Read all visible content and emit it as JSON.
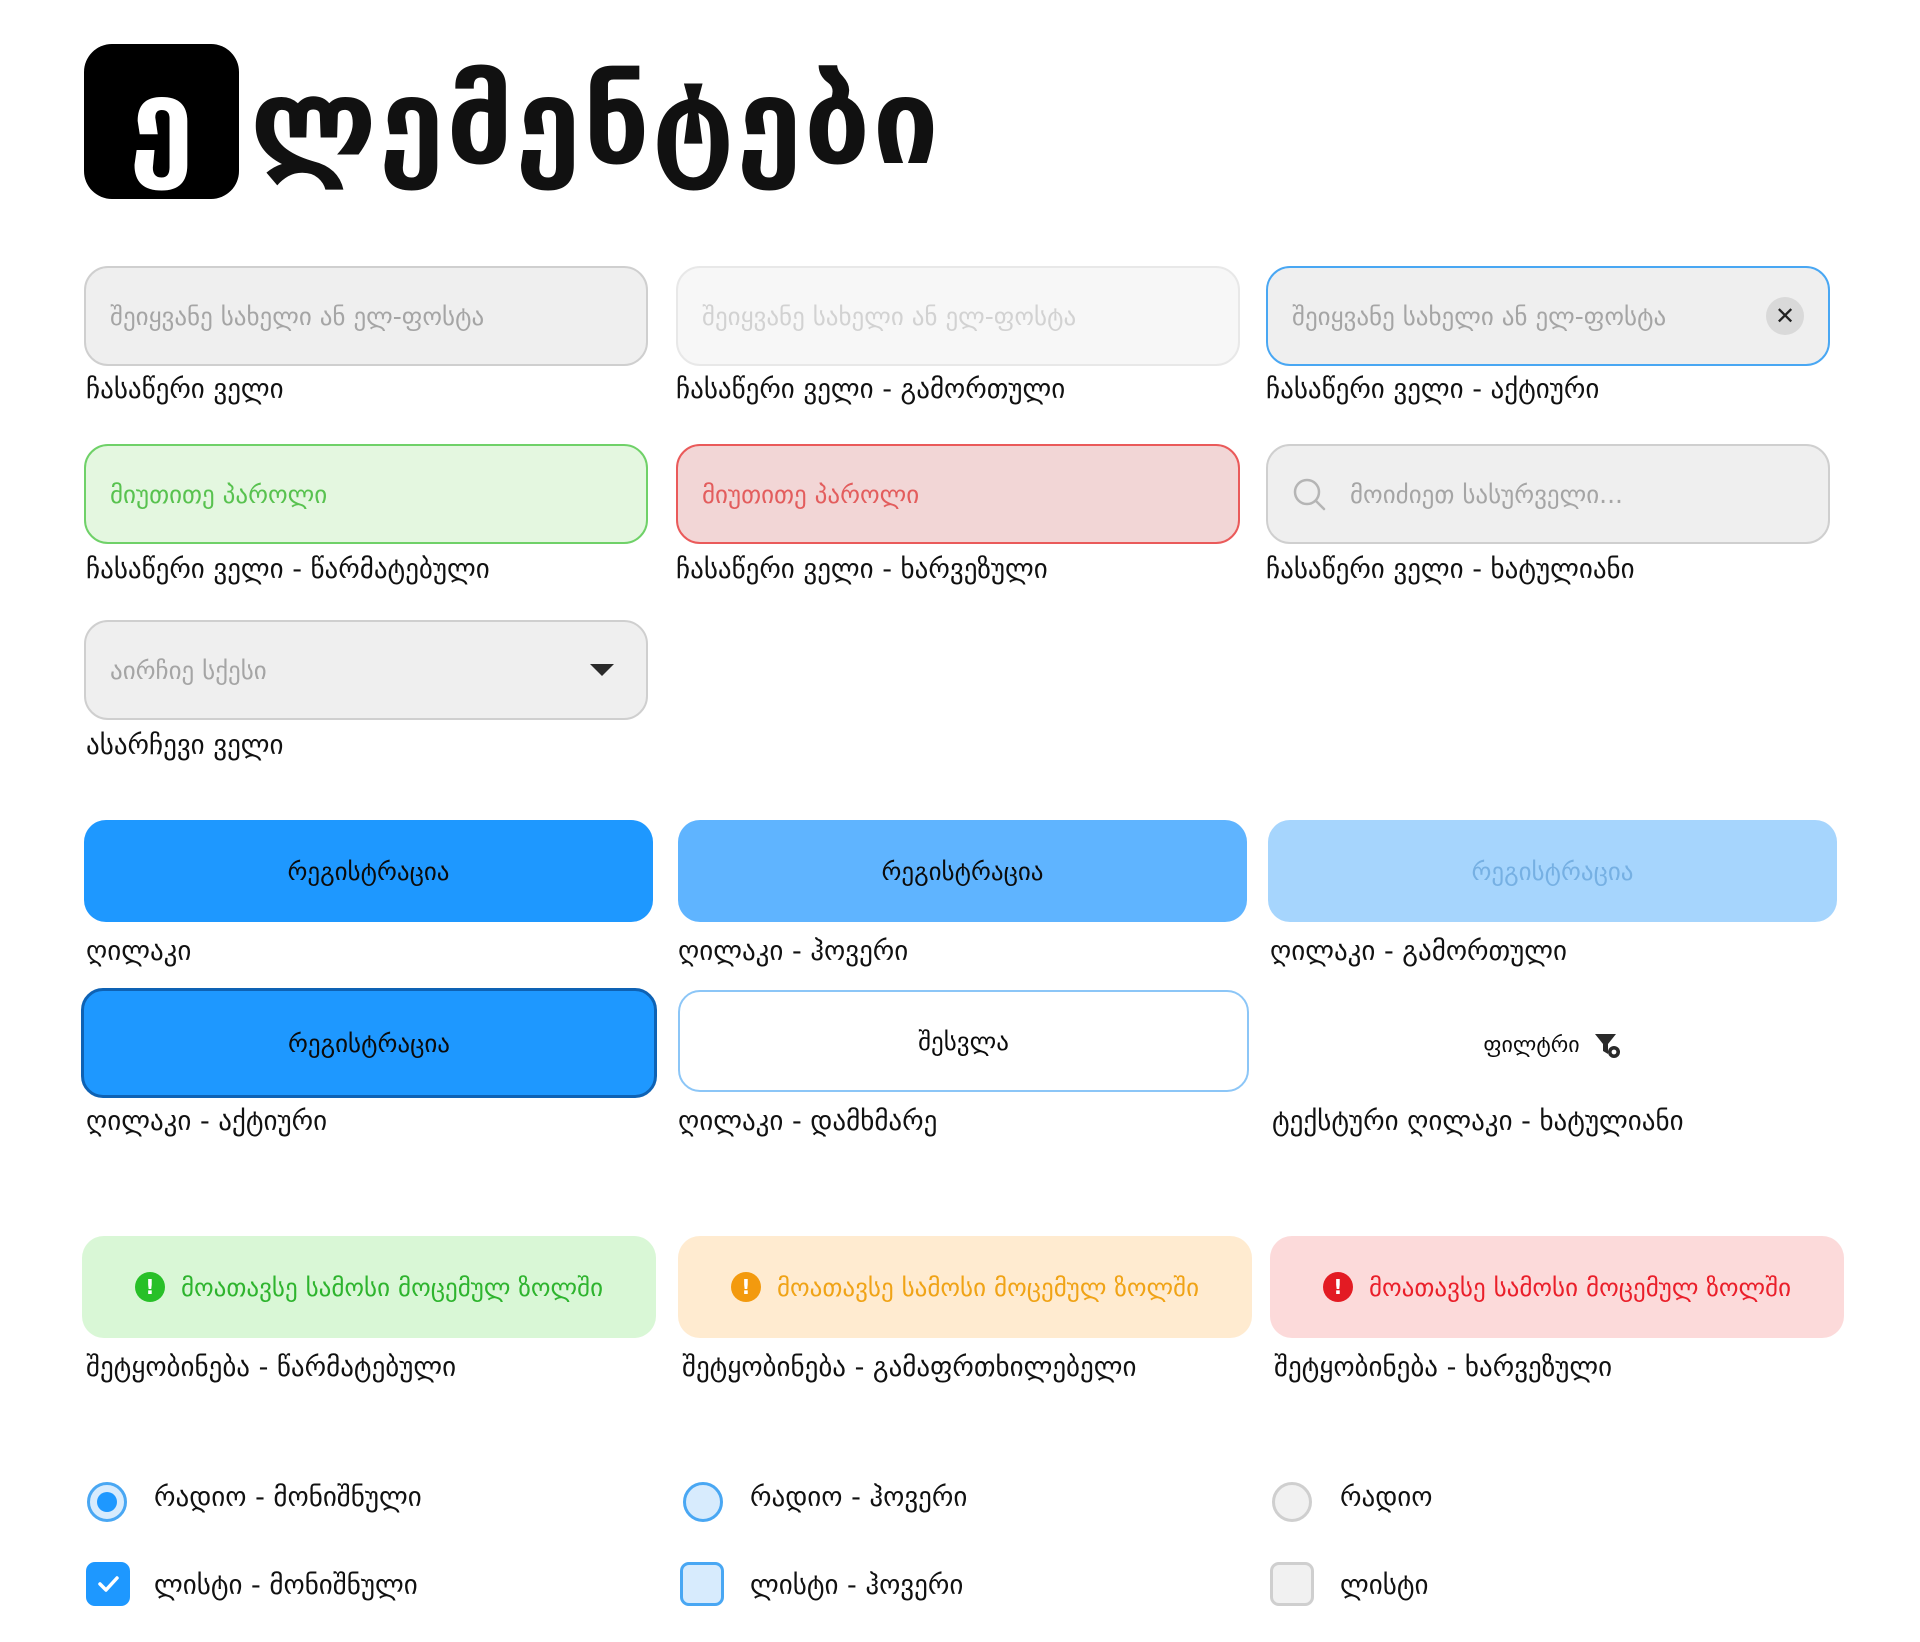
{
  "title": {
    "initial": "ე",
    "rest": "ლემენტები"
  },
  "inputs": {
    "placeholder_name": "შეიყვანე სახელი ან ელ-ფოსტა",
    "placeholder_password": "მიუთითე პაროლი",
    "placeholder_search": "მოიძიეთ სასურველი...",
    "placeholder_select": "აირჩიე სქესი",
    "clear_symbol": "✕",
    "labels": {
      "default": "ჩასაწერი ველი",
      "disabled": "ჩასაწერი ველი - გამორთული",
      "active": "ჩასაწერი ველი - აქტიური",
      "success": "ჩასაწერი ველი - წარმატებული",
      "error": "ჩასაწერი ველი - ხარვეზული",
      "icon": "ჩასაწერი ველი - ხატულიანი",
      "select": "ასარჩევი ველი"
    }
  },
  "buttons": {
    "register": "რეგისტრაცია",
    "login": "შესვლა",
    "filter": "ფილტრი",
    "labels": {
      "primary": "ღილაკი",
      "hover": "ღილაკი - ჰოვერი",
      "disabled": "ღილაკი - გამორთული",
      "active": "ღილაკი - აქტიური",
      "secondary": "ღილაკი - დამხმარე",
      "text_icon": "ტექსტური ღილაკი - ხატულიანი"
    }
  },
  "alerts": {
    "message": "მოათავსე სამოსი მოცემულ ზოლში",
    "icon_symbol": "!",
    "labels": {
      "success": "შეტყობინება - წარმატებული",
      "warning": "შეტყობინება - გამაფრთხილებელი",
      "error": "შეტყობინება - ხარვეზული"
    }
  },
  "controls": {
    "radio_checked": "რადიო - მონიშნული",
    "radio_hover": "რადიო - ჰოვერი",
    "radio": "რადიო",
    "checkbox_checked": "ლისტი - მონიშნული",
    "checkbox_hover": "ლისტი - ჰოვერი",
    "checkbox": "ლისტი"
  },
  "colors": {
    "primary": "#1e98ff",
    "hover": "#5fb4ff",
    "disabled": "#a6d5fd",
    "success": "#28c028",
    "warning": "#f39a0e",
    "error": "#e31b23"
  }
}
